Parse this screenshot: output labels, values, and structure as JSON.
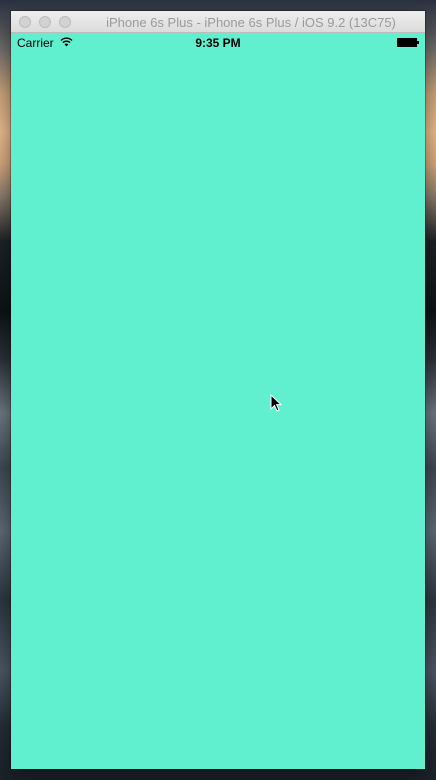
{
  "window": {
    "title": "iPhone 6s Plus - iPhone 6s Plus / iOS 9.2 (13C75)"
  },
  "statusbar": {
    "carrier": "Carrier",
    "time": "9:35 PM",
    "wifi_icon": "wifi-icon",
    "battery_icon": "battery-icon"
  },
  "colors": {
    "app_background": "#60f0cf"
  },
  "icons": {
    "cursor": "arrow-cursor-icon"
  }
}
